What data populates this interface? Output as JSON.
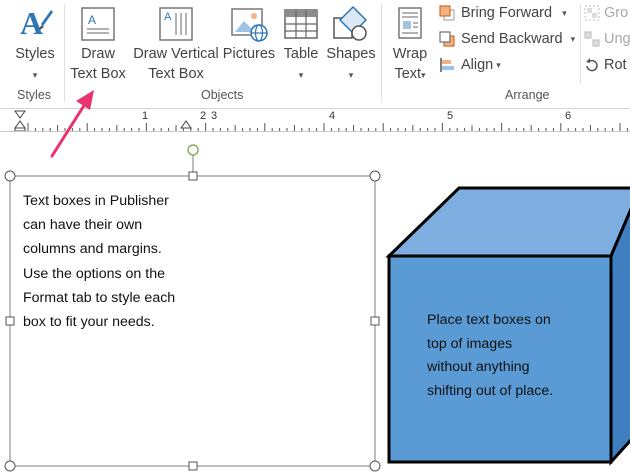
{
  "ribbon": {
    "styles": {
      "label": "Styles",
      "caret": "▾",
      "group_label": "Styles"
    },
    "objects": {
      "draw_text_box": {
        "line1": "Draw",
        "line2": "Text Box"
      },
      "draw_vertical_text_box": {
        "line1": "Draw Vertical",
        "line2": "Text Box"
      },
      "pictures": {
        "label": "Pictures"
      },
      "table": {
        "label": "Table",
        "caret": "▾"
      },
      "shapes": {
        "label": "Shapes",
        "caret": "▾"
      },
      "group_label": "Objects"
    },
    "arrange": {
      "wrap_text": {
        "line1": "Wrap",
        "line2": "Text",
        "caret": "▾"
      },
      "bring_forward": {
        "label": "Bring Forward",
        "caret": "▾"
      },
      "send_backward": {
        "label": "Send Backward",
        "caret": "▾"
      },
      "align": {
        "label": "Align",
        "caret": "▾"
      },
      "group": {
        "label": "Gro"
      },
      "ungroup": {
        "label": "Ung"
      },
      "rotate": {
        "label": "Rot"
      },
      "group_label": "Arrange"
    }
  },
  "ruler": {
    "numbers": [
      "1",
      "2",
      "3",
      "4",
      "5",
      "6"
    ]
  },
  "canvas": {
    "text_box": {
      "lines": [
        "Text boxes in Publisher",
        "can have their own",
        "columns and margins.",
        "Use the options on the",
        "Format tab to style each",
        "box to fit your needs."
      ]
    },
    "cube": {
      "lines": [
        "Place text boxes on",
        "top of images",
        "without anything",
        "shifting out of place."
      ],
      "front_color": "#5b9bd5",
      "top_color": "#7eaee0",
      "side_color": "#3f7fbf"
    },
    "annotation_color": "#e8336c"
  }
}
